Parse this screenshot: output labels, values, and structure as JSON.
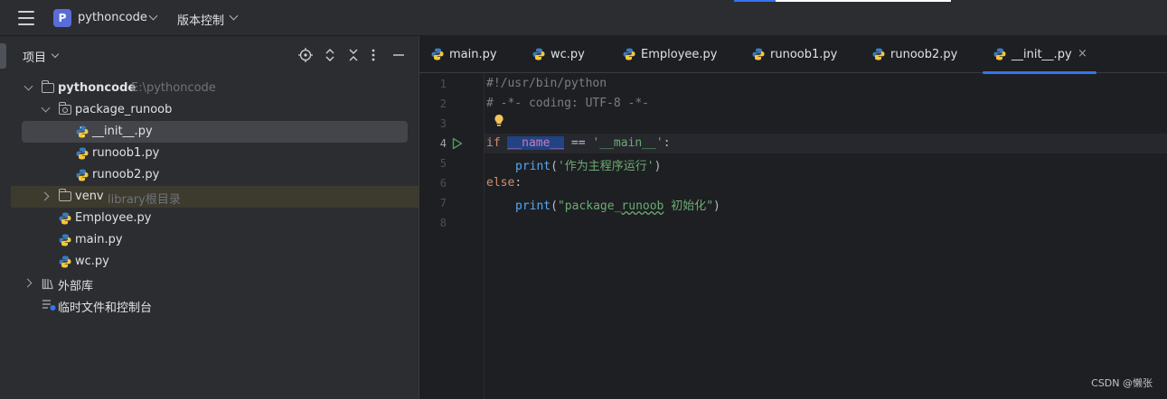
{
  "titlebar": {
    "menu_icon": "hamburger-menu-icon",
    "project_badge": "P",
    "project_name": "pythoncode",
    "vcs_label": "版本控制",
    "accent_color": "#3574f0"
  },
  "project_panel": {
    "title": "项目",
    "toolbar_icons": [
      "locate-icon",
      "expand-all-icon",
      "collapse-all-icon",
      "more-options-icon",
      "hide-panel-icon"
    ],
    "tree": [
      {
        "label": "pythoncode",
        "hint": "E:\\pythoncode",
        "type": "folder",
        "expanded": true
      },
      {
        "label": "package_runoob",
        "type": "package",
        "expanded": true
      },
      {
        "label": "__init__.py",
        "type": "python-file",
        "selected": true
      },
      {
        "label": "runoob1.py",
        "type": "python-file"
      },
      {
        "label": "runoob2.py",
        "type": "python-file"
      },
      {
        "label": "venv",
        "hint": "library根目录",
        "type": "folder",
        "expanded": false
      },
      {
        "label": "Employee.py",
        "type": "python-file"
      },
      {
        "label": "main.py",
        "type": "python-file"
      },
      {
        "label": "wc.py",
        "type": "python-file"
      },
      {
        "label": "外部库",
        "type": "library",
        "expanded": false
      },
      {
        "label": "临时文件和控制台",
        "type": "scratches"
      }
    ]
  },
  "editor": {
    "tabs": [
      {
        "label": "main.py"
      },
      {
        "label": "wc.py"
      },
      {
        "label": "Employee.py"
      },
      {
        "label": "runoob1.py"
      },
      {
        "label": "runoob2.py"
      },
      {
        "label": "__init__.py",
        "active": true,
        "close": "×"
      }
    ],
    "line_numbers": [
      "1",
      "2",
      "3",
      "4",
      "5",
      "6",
      "7",
      "8"
    ],
    "code": {
      "l1": "#!/usr/bin/python",
      "l2": "# -*- coding: UTF-8 -*-",
      "l4_kw": "if",
      "l4_var": "__name__",
      "l4_op": " == ",
      "l4_str": "'__main__'",
      "l4_end": ":",
      "l5_fn": "print",
      "l5_open": "(",
      "l5_str": "'作为主程序运行'",
      "l5_close": ")",
      "l6_kw": "else",
      "l6_end": ":",
      "l7_fn": "print",
      "l7_open": "(",
      "l7_str_a": "\"package_",
      "l7_str_b": "runoob",
      "l7_str_c": " 初始化\"",
      "l7_close": ")"
    }
  },
  "watermark": "CSDN @懒张"
}
